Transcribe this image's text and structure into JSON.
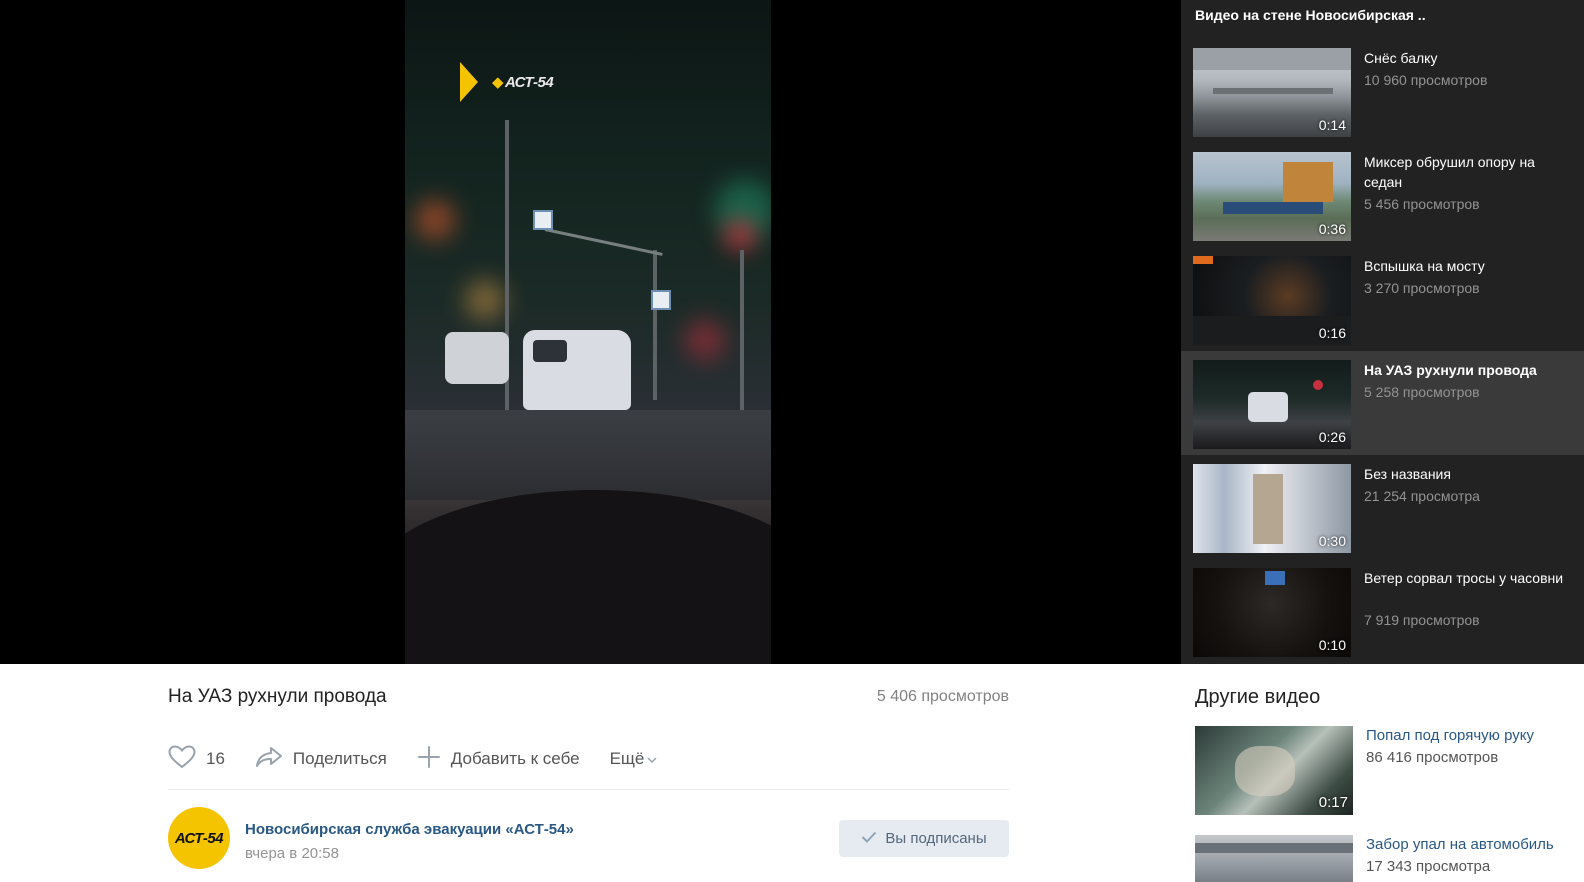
{
  "video": {
    "title": "На УАЗ рухнули провода",
    "views": "5 406 просмотров",
    "likes": "16",
    "share_label": "Поделиться",
    "add_label": "Добавить к себе",
    "more_label": "Ещё",
    "channel_watermark": "АСТ-54"
  },
  "owner": {
    "name": "Новосибирская служба эвакуации «АСТ-54»",
    "time": "вчера в 20:58",
    "subscribed_label": "Вы подписаны",
    "avatar_text": "АСТ-54"
  },
  "playlist": {
    "title": "Видео на стене Новосибирская ..",
    "items": [
      {
        "name": "Снёс балку",
        "views": "10 960 просмотров",
        "duration": "0:14",
        "active": false
      },
      {
        "name": "Миксер обрушил опору на седан",
        "views": "5 456 просмотров",
        "duration": "0:36",
        "active": false
      },
      {
        "name": "Вспышка на мосту",
        "views": "3 270 просмотров",
        "duration": "0:16",
        "active": false
      },
      {
        "name": "На УАЗ рухнули провода",
        "views": "5 258 просмотров",
        "duration": "0:26",
        "active": true
      },
      {
        "name": "Без названия",
        "views": "21 254 просмотра",
        "duration": "0:30",
        "active": false
      },
      {
        "name": "Ветер сорвал тросы у часовни",
        "views": "7 919 просмотров",
        "duration": "0:10",
        "active": false
      }
    ]
  },
  "other_videos": {
    "title": "Другие видео",
    "items": [
      {
        "name": "Попал под горячую руку",
        "views": "86 416 просмотров",
        "duration": "0:17"
      },
      {
        "name": "Забор упал на автомобиль",
        "views": "17 343 просмотра",
        "duration": ""
      }
    ]
  },
  "colors": {
    "link": "#2a5885",
    "sidebar_bg": "#222222",
    "active_item_bg": "#3a3a3a",
    "brand_yellow": "#f5c400"
  },
  "icons": [
    "heart-icon",
    "share-arrow-icon",
    "plus-icon",
    "chevron-down-icon",
    "check-icon"
  ]
}
